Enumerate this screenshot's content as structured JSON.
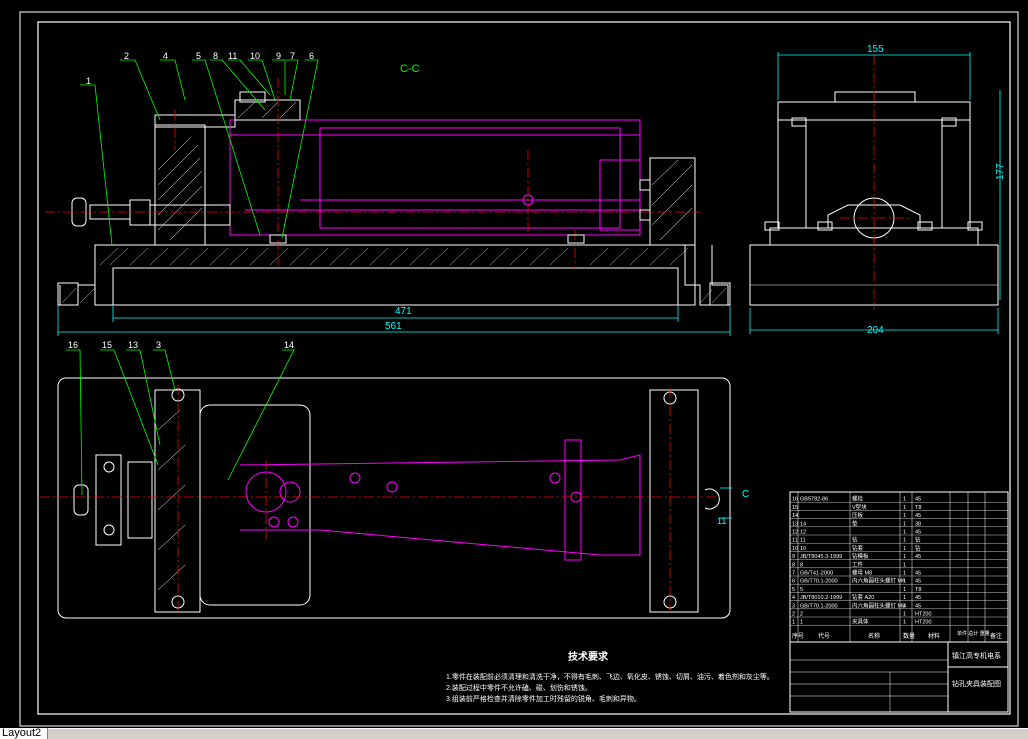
{
  "section_label": "C-C",
  "callouts_front": [
    "1",
    "2",
    "4",
    "5",
    "8",
    "11",
    "10",
    "9",
    "7",
    "6"
  ],
  "callouts_plan": [
    "16",
    "15",
    "13",
    "3",
    "14"
  ],
  "dimensions": {
    "front_inner_length": "471",
    "front_overall_length": "561",
    "side_width_top": "155",
    "side_height": "177",
    "side_width_base": "204",
    "plan_offset": "11"
  },
  "section_mark_plan": "C",
  "tech_requirements": {
    "title": "技术要求",
    "lines": [
      "1.零件在装配前必须清理和清洗干净，不得有毛刺、飞边、氧化皮、锈蚀、切屑、油污、着色剂和灰尘等。",
      "2.装配过程中零件不允许磕、碰、划伤和锈蚀。",
      "3.组装前严格检查并清除零件加工时残留的锐角、毛刺和异物。"
    ]
  },
  "bom": {
    "rows": [
      {
        "no": "16",
        "code": "GB5782-86",
        "name": "螺栓",
        "qty": "1",
        "mat": "45"
      },
      {
        "no": "15",
        "code": "",
        "name": "V型块",
        "qty": "1",
        "mat": "T8"
      },
      {
        "no": "14",
        "code": "",
        "name": "压板",
        "qty": "1",
        "mat": "45"
      },
      {
        "no": "13",
        "code": "14",
        "name": "垫",
        "qty": "1",
        "mat": "38"
      },
      {
        "no": "12",
        "code": "12",
        "name": "",
        "qty": "1",
        "mat": "45"
      },
      {
        "no": "11",
        "code": "11",
        "name": "钻",
        "qty": "1",
        "mat": "钻"
      },
      {
        "no": "10",
        "code": "10",
        "name": "钻套",
        "qty": "1",
        "mat": "钻"
      },
      {
        "no": "9",
        "code": "JB/T8045.3-1999",
        "name": "钻模板",
        "qty": "1",
        "mat": "45"
      },
      {
        "no": "8",
        "code": "8",
        "name": "工件",
        "qty": "1",
        "mat": ""
      },
      {
        "no": "7",
        "code": "GB/T41-2000",
        "name": "螺母 M8",
        "qty": "1",
        "mat": "45"
      },
      {
        "no": "6",
        "code": "GB/T70.1-2000",
        "name": "内六角圆柱头螺钉 M6",
        "qty": "1",
        "mat": "45"
      },
      {
        "no": "5",
        "code": "5",
        "name": "",
        "qty": "1",
        "mat": "T8"
      },
      {
        "no": "4",
        "code": "JB/T8010.2-1999",
        "name": "钻套 A20",
        "qty": "1",
        "mat": "45"
      },
      {
        "no": "3",
        "code": "GB/T70.1-2000",
        "name": "内六角圆柱头螺钉 M8",
        "qty": "4",
        "mat": "45"
      },
      {
        "no": "2",
        "code": "2",
        "name": "",
        "qty": "1",
        "mat": "HT200"
      },
      {
        "no": "1",
        "code": "1",
        "name": "夹具体",
        "qty": "1",
        "mat": "HT200"
      }
    ],
    "header": {
      "no": "序号",
      "code": "代号",
      "name": "名称",
      "qty": "数量",
      "mat": "材料",
      "weight": "单件 总计 重量",
      "note": "备注"
    }
  },
  "title_block": {
    "company": "镇江高专机电系",
    "drawing_name": "钻孔夹具装配图"
  },
  "layout_tab": "Layout2"
}
